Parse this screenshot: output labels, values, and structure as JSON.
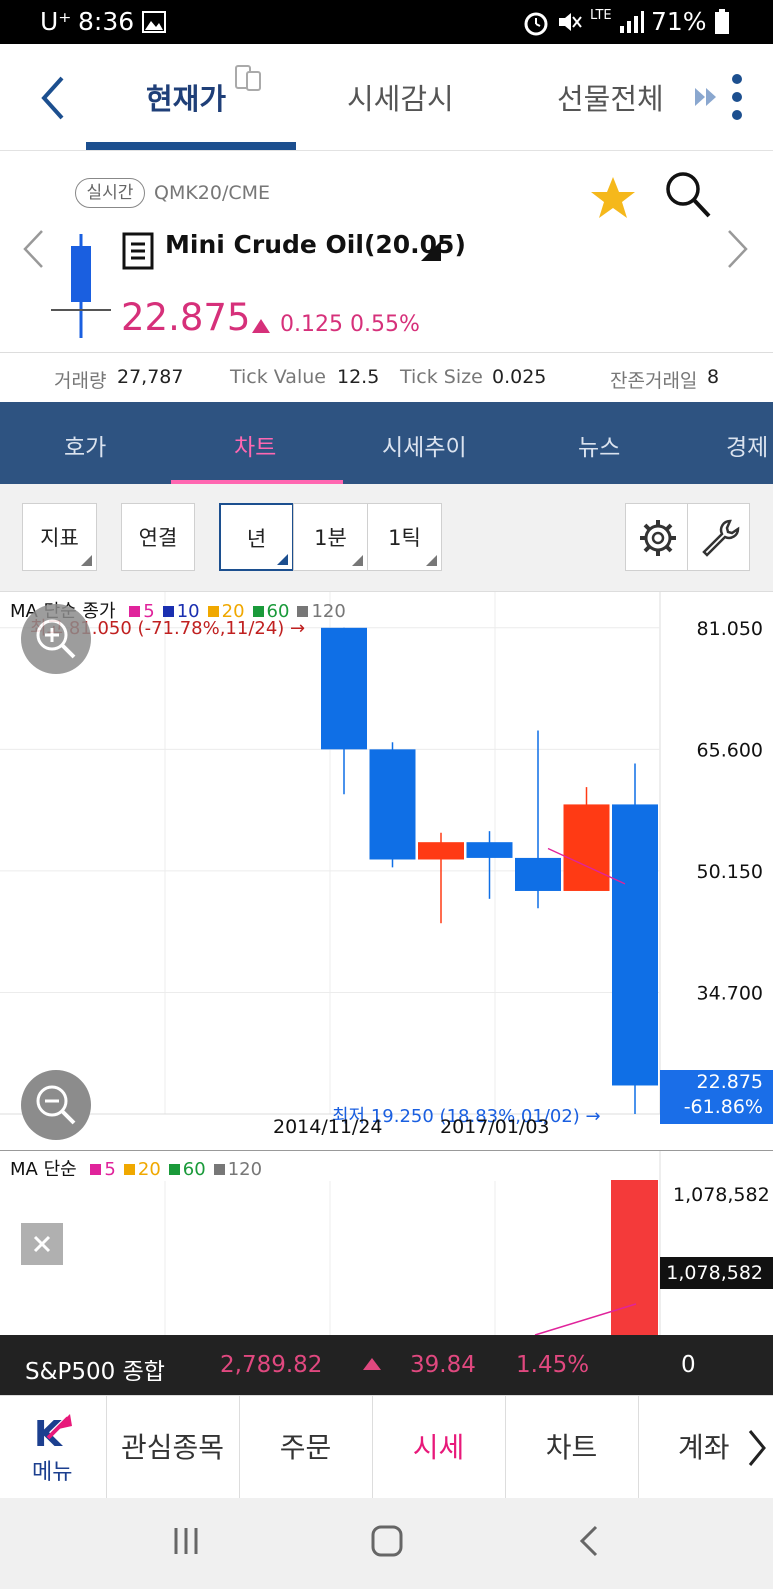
{
  "status_bar": {
    "carrier": "U⁺",
    "time": "8:36",
    "network": "LTE",
    "battery": "71%"
  },
  "top_nav": {
    "tabs": [
      "현재가",
      "시세감시",
      "선물전체"
    ]
  },
  "quote": {
    "badge": "실시간",
    "market_code": "QMK20/CME",
    "name": "Mini Crude Oil(20.05)",
    "price": "22.875",
    "change": "0.125",
    "change_pct": "0.55%",
    "volume_label": "거래량",
    "volume": "27,787",
    "tick_value_label": "Tick Value",
    "tick_value": "12.5",
    "tick_size_label": "Tick Size",
    "tick_size": "0.025",
    "remaining_label": "잔존거래일",
    "remaining": "8"
  },
  "sub_tabs": [
    "호가",
    "차트",
    "시세추이",
    "뉴스",
    "경제"
  ],
  "toolbar": {
    "indicator": "지표",
    "link": "연결",
    "period": "년",
    "minute": "1분",
    "tick": "1틱"
  },
  "chart": {
    "legend_prefix": "MA 단순 종가",
    "ma_periods": [
      "5",
      "10",
      "20",
      "60",
      "120"
    ],
    "ma_colors": [
      "#e0239b",
      "#1a2fb0",
      "#f0a800",
      "#1a9a3a",
      "#777777"
    ],
    "high_note": "최고 81.050 (-71.78%,11/24) →",
    "low_note": "최저 19.250 (18.83%,01/02) →",
    "last_price": "22.875",
    "last_pct": "-61.86%",
    "date_labels": [
      "2014/11/24",
      "2017/01/03"
    ]
  },
  "chart_data": {
    "type": "candlestick",
    "y_ticks": [
      "81.050",
      "65.600",
      "50.150",
      "34.700"
    ],
    "ylim": [
      19.25,
      85.6
    ],
    "candles": [
      {
        "open": 81.05,
        "close": 65.6,
        "high": 81.05,
        "low": 59.9
      },
      {
        "open": 65.6,
        "close": 51.6,
        "high": 66.5,
        "low": 50.6
      },
      {
        "open": 51.6,
        "close": 53.8,
        "high": 55.0,
        "low": 43.5
      },
      {
        "open": 53.8,
        "close": 51.8,
        "high": 55.2,
        "low": 46.6
      },
      {
        "open": 51.8,
        "close": 47.6,
        "high": 68.0,
        "low": 45.4
      },
      {
        "open": 47.6,
        "close": 58.6,
        "high": 60.8,
        "low": 47.6
      },
      {
        "open": 58.6,
        "close": 22.875,
        "high": 63.8,
        "low": 19.25
      }
    ],
    "volume": {
      "legend_prefix": "MA 단순",
      "ma_periods": [
        "5",
        "20",
        "60",
        "120"
      ],
      "ma_colors": [
        "#e0239b",
        "#f0a800",
        "#1a9a3a",
        "#777777"
      ],
      "max_label": "1,078,582",
      "current_label": "1,078,582"
    }
  },
  "ticker": {
    "name": "S&P500 종합",
    "value": "2,789.82",
    "change": "39.84",
    "change_pct": "1.45%",
    "extra": "0"
  },
  "bottom_nav": {
    "menu_label": "메뉴",
    "items": [
      "관심종목",
      "주문",
      "시세",
      "차트",
      "계좌"
    ]
  }
}
